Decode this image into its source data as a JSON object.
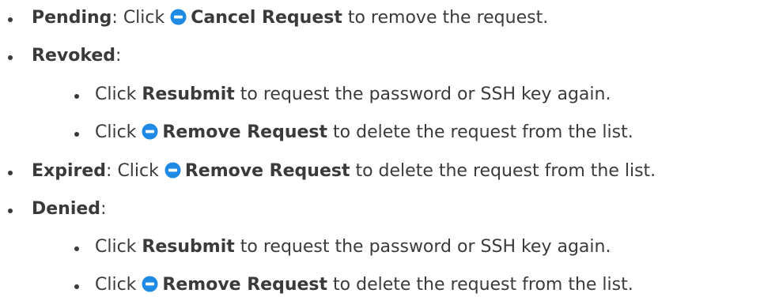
{
  "items": [
    {
      "label": "Pending",
      "colon": ": ",
      "click": "Click ",
      "icon": "minus-circle-icon",
      "action": "Cancel Request",
      "rest": " to remove the request."
    },
    {
      "label": "Revoked",
      "colon": ":",
      "subitems": [
        {
          "click": "Click ",
          "action": "Resubmit",
          "rest": " to request the password or SSH key again."
        },
        {
          "click": "Click ",
          "icon": "minus-circle-icon",
          "action": "Remove Request",
          "rest": " to delete the request from the list."
        }
      ]
    },
    {
      "label": "Expired",
      "colon": ": ",
      "click": "Click ",
      "icon": "minus-circle-icon",
      "action": "Remove Request",
      "rest": " to delete the request from the list."
    },
    {
      "label": "Denied",
      "colon": ":",
      "subitems": [
        {
          "click": "Click ",
          "action": "Resubmit",
          "rest": " to request the password or SSH key again."
        },
        {
          "click": "Click ",
          "icon": "minus-circle-icon",
          "action": "Remove Request",
          "rest": " to delete the request from the list."
        }
      ]
    }
  ],
  "colors": {
    "text": "#3a3a3a",
    "icon": "#1e8ae6"
  }
}
